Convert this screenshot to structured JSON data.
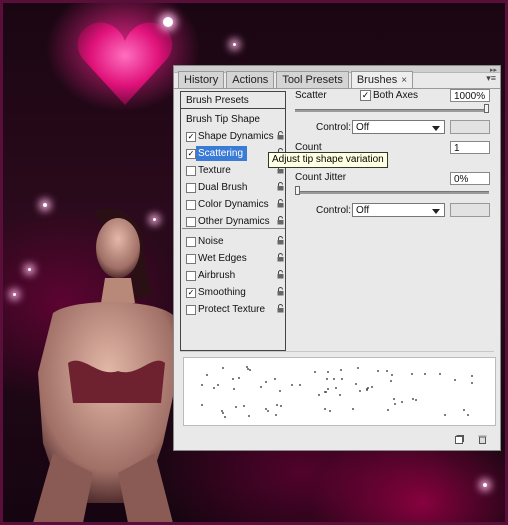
{
  "tabs": [
    {
      "label": "History",
      "active": false
    },
    {
      "label": "Actions",
      "active": false
    },
    {
      "label": "Tool Presets",
      "active": false
    },
    {
      "label": "Brushes",
      "active": true
    }
  ],
  "tab_close_glyph": "×",
  "menu_glyph": "▾≡",
  "collapse_glyph": "▸▸",
  "brush_presets_label": "Brush Presets",
  "brush_tip_shape_label": "Brush Tip Shape",
  "options": [
    {
      "label": "Shape Dynamics",
      "checked": true,
      "selected": false,
      "lock": true
    },
    {
      "label": "Scattering",
      "checked": true,
      "selected": true,
      "lock": true
    },
    {
      "label": "Texture",
      "checked": false,
      "selected": false,
      "lock": true
    },
    {
      "label": "Dual Brush",
      "checked": false,
      "selected": false,
      "lock": true
    },
    {
      "label": "Color Dynamics",
      "checked": false,
      "selected": false,
      "lock": true
    },
    {
      "label": "Other Dynamics",
      "checked": false,
      "selected": false,
      "lock": true
    },
    {
      "label": "Noise",
      "checked": false,
      "selected": false,
      "lock": true
    },
    {
      "label": "Wet Edges",
      "checked": false,
      "selected": false,
      "lock": true
    },
    {
      "label": "Airbrush",
      "checked": false,
      "selected": false,
      "lock": true
    },
    {
      "label": "Smoothing",
      "checked": true,
      "selected": false,
      "lock": true
    },
    {
      "label": "Protect Texture",
      "checked": false,
      "selected": false,
      "lock": true
    }
  ],
  "tooltip": "Adjust tip shape variation",
  "scatter": {
    "label": "Scatter",
    "both_axes_label": "Both Axes",
    "both_axes_checked": true,
    "value": "1000%",
    "slider_fraction": 1.0
  },
  "control1": {
    "label": "Control:",
    "value": "Off"
  },
  "count": {
    "label": "Count",
    "value": "1"
  },
  "count_jitter": {
    "label": "Count Jitter",
    "value": "0%",
    "slider_fraction": 0.0
  },
  "control2": {
    "label": "Control:",
    "value": "Off"
  },
  "check_glyph": "✓",
  "icons": {
    "lock": "lock-icon",
    "new": "new-preset-icon",
    "trash": "trash-icon"
  },
  "colors": {
    "selection": "#3a7bd5",
    "tooltip_bg": "#ffffe1",
    "panel_bg": "#e9e9e9"
  }
}
